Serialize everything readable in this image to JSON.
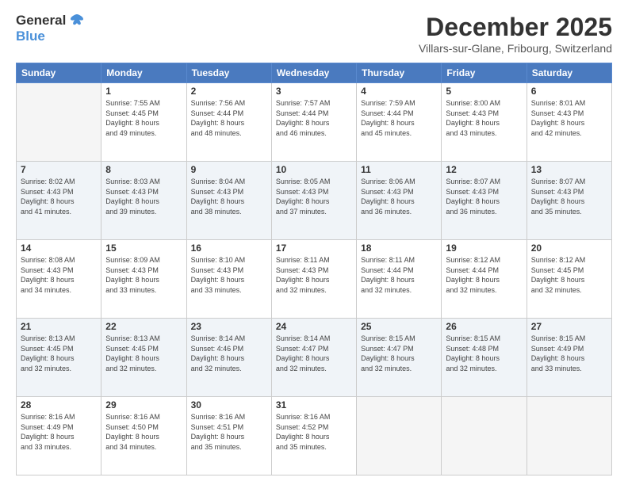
{
  "header": {
    "logo": {
      "line1": "General",
      "line2": "Blue"
    },
    "title": "December 2025",
    "subtitle": "Villars-sur-Glane, Fribourg, Switzerland"
  },
  "days_of_week": [
    "Sunday",
    "Monday",
    "Tuesday",
    "Wednesday",
    "Thursday",
    "Friday",
    "Saturday"
  ],
  "weeks": [
    [
      {
        "day": "",
        "info": ""
      },
      {
        "day": "1",
        "info": "Sunrise: 7:55 AM\nSunset: 4:45 PM\nDaylight: 8 hours\nand 49 minutes."
      },
      {
        "day": "2",
        "info": "Sunrise: 7:56 AM\nSunset: 4:44 PM\nDaylight: 8 hours\nand 48 minutes."
      },
      {
        "day": "3",
        "info": "Sunrise: 7:57 AM\nSunset: 4:44 PM\nDaylight: 8 hours\nand 46 minutes."
      },
      {
        "day": "4",
        "info": "Sunrise: 7:59 AM\nSunset: 4:44 PM\nDaylight: 8 hours\nand 45 minutes."
      },
      {
        "day": "5",
        "info": "Sunrise: 8:00 AM\nSunset: 4:43 PM\nDaylight: 8 hours\nand 43 minutes."
      },
      {
        "day": "6",
        "info": "Sunrise: 8:01 AM\nSunset: 4:43 PM\nDaylight: 8 hours\nand 42 minutes."
      }
    ],
    [
      {
        "day": "7",
        "info": "Sunrise: 8:02 AM\nSunset: 4:43 PM\nDaylight: 8 hours\nand 41 minutes."
      },
      {
        "day": "8",
        "info": "Sunrise: 8:03 AM\nSunset: 4:43 PM\nDaylight: 8 hours\nand 39 minutes."
      },
      {
        "day": "9",
        "info": "Sunrise: 8:04 AM\nSunset: 4:43 PM\nDaylight: 8 hours\nand 38 minutes."
      },
      {
        "day": "10",
        "info": "Sunrise: 8:05 AM\nSunset: 4:43 PM\nDaylight: 8 hours\nand 37 minutes."
      },
      {
        "day": "11",
        "info": "Sunrise: 8:06 AM\nSunset: 4:43 PM\nDaylight: 8 hours\nand 36 minutes."
      },
      {
        "day": "12",
        "info": "Sunrise: 8:07 AM\nSunset: 4:43 PM\nDaylight: 8 hours\nand 36 minutes."
      },
      {
        "day": "13",
        "info": "Sunrise: 8:07 AM\nSunset: 4:43 PM\nDaylight: 8 hours\nand 35 minutes."
      }
    ],
    [
      {
        "day": "14",
        "info": "Sunrise: 8:08 AM\nSunset: 4:43 PM\nDaylight: 8 hours\nand 34 minutes."
      },
      {
        "day": "15",
        "info": "Sunrise: 8:09 AM\nSunset: 4:43 PM\nDaylight: 8 hours\nand 33 minutes."
      },
      {
        "day": "16",
        "info": "Sunrise: 8:10 AM\nSunset: 4:43 PM\nDaylight: 8 hours\nand 33 minutes."
      },
      {
        "day": "17",
        "info": "Sunrise: 8:11 AM\nSunset: 4:43 PM\nDaylight: 8 hours\nand 32 minutes."
      },
      {
        "day": "18",
        "info": "Sunrise: 8:11 AM\nSunset: 4:44 PM\nDaylight: 8 hours\nand 32 minutes."
      },
      {
        "day": "19",
        "info": "Sunrise: 8:12 AM\nSunset: 4:44 PM\nDaylight: 8 hours\nand 32 minutes."
      },
      {
        "day": "20",
        "info": "Sunrise: 8:12 AM\nSunset: 4:45 PM\nDaylight: 8 hours\nand 32 minutes."
      }
    ],
    [
      {
        "day": "21",
        "info": "Sunrise: 8:13 AM\nSunset: 4:45 PM\nDaylight: 8 hours\nand 32 minutes."
      },
      {
        "day": "22",
        "info": "Sunrise: 8:13 AM\nSunset: 4:45 PM\nDaylight: 8 hours\nand 32 minutes."
      },
      {
        "day": "23",
        "info": "Sunrise: 8:14 AM\nSunset: 4:46 PM\nDaylight: 8 hours\nand 32 minutes."
      },
      {
        "day": "24",
        "info": "Sunrise: 8:14 AM\nSunset: 4:47 PM\nDaylight: 8 hours\nand 32 minutes."
      },
      {
        "day": "25",
        "info": "Sunrise: 8:15 AM\nSunset: 4:47 PM\nDaylight: 8 hours\nand 32 minutes."
      },
      {
        "day": "26",
        "info": "Sunrise: 8:15 AM\nSunset: 4:48 PM\nDaylight: 8 hours\nand 32 minutes."
      },
      {
        "day": "27",
        "info": "Sunrise: 8:15 AM\nSunset: 4:49 PM\nDaylight: 8 hours\nand 33 minutes."
      }
    ],
    [
      {
        "day": "28",
        "info": "Sunrise: 8:16 AM\nSunset: 4:49 PM\nDaylight: 8 hours\nand 33 minutes."
      },
      {
        "day": "29",
        "info": "Sunrise: 8:16 AM\nSunset: 4:50 PM\nDaylight: 8 hours\nand 34 minutes."
      },
      {
        "day": "30",
        "info": "Sunrise: 8:16 AM\nSunset: 4:51 PM\nDaylight: 8 hours\nand 35 minutes."
      },
      {
        "day": "31",
        "info": "Sunrise: 8:16 AM\nSunset: 4:52 PM\nDaylight: 8 hours\nand 35 minutes."
      },
      {
        "day": "",
        "info": ""
      },
      {
        "day": "",
        "info": ""
      },
      {
        "day": "",
        "info": ""
      }
    ]
  ]
}
